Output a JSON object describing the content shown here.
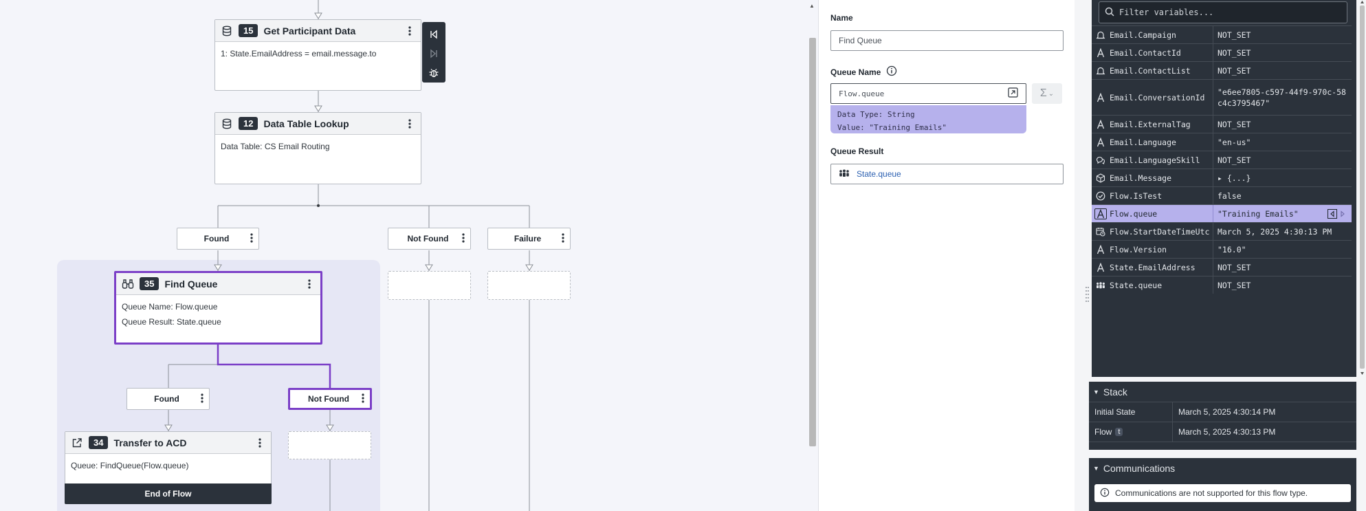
{
  "canvas": {
    "get_participant": {
      "number": "15",
      "title": "Get Participant Data",
      "line1": "1: State.EmailAddress = email.message.to"
    },
    "data_table_lookup": {
      "number": "12",
      "title": "Data Table Lookup",
      "line1": "Data Table: CS Email Routing"
    },
    "branches": {
      "found": "Found",
      "not_found": "Not Found",
      "failure": "Failure"
    },
    "find_queue": {
      "number": "35",
      "title": "Find Queue",
      "line1": "Queue Name: Flow.queue",
      "line2": "Queue Result: State.queue"
    },
    "inner_branches": {
      "found": "Found",
      "not_found": "Not Found"
    },
    "transfer": {
      "number": "34",
      "title": "Transfer to ACD",
      "line1": "Queue: FindQueue(Flow.queue)",
      "end": "End of Flow"
    }
  },
  "properties": {
    "name_label": "Name",
    "name_value": "Find Queue",
    "queue_name_label": "Queue Name",
    "queue_name_value": "Flow.queue",
    "tooltip_type": "Data Type: String",
    "tooltip_value": "Value:  \"Training Emails\"",
    "queue_result_label": "Queue Result",
    "queue_result_value": "State.queue"
  },
  "variables": {
    "filter_placeholder": "Filter variables...",
    "rows": [
      {
        "icon": "bell-icon",
        "name": "Email.Campaign",
        "value": "NOT_SET"
      },
      {
        "icon": "text-icon",
        "name": "Email.ContactId",
        "value": "NOT_SET"
      },
      {
        "icon": "bell-icon",
        "name": "Email.ContactList",
        "value": "NOT_SET"
      },
      {
        "icon": "text-icon",
        "name": "Email.ConversationId",
        "value": "\"e6ee7805-c597-44f9-970c-58c4c3795467\""
      },
      {
        "icon": "text-icon",
        "name": "Email.ExternalTag",
        "value": "NOT_SET"
      },
      {
        "icon": "text-icon",
        "name": "Email.Language",
        "value": "\"en-us\""
      },
      {
        "icon": "chat-icon",
        "name": "Email.LanguageSkill",
        "value": "NOT_SET"
      },
      {
        "icon": "cube-icon",
        "name": "Email.Message",
        "value": "▸ {...}"
      },
      {
        "icon": "check-circle-icon",
        "name": "Flow.IsTest",
        "value": "false"
      },
      {
        "icon": "text-icon",
        "name": "Flow.queue",
        "value": "\"Training Emails\""
      },
      {
        "icon": "calendar-clock-icon",
        "name": "Flow.StartDateTimeUtc",
        "value": "March 5, 2025 4:30:13 PM"
      },
      {
        "icon": "text-icon",
        "name": "Flow.Version",
        "value": "\"16.0\""
      },
      {
        "icon": "text-icon",
        "name": "State.EmailAddress",
        "value": "NOT_SET"
      },
      {
        "icon": "people-icon",
        "name": "State.queue",
        "value": "NOT_SET"
      }
    ]
  },
  "stack": {
    "title": "Stack",
    "rows": [
      {
        "key": "Initial State",
        "badge": "",
        "value": "March 5, 2025 4:30:14 PM"
      },
      {
        "key": "Flow",
        "badge": "t",
        "value": "March 5, 2025 4:30:13 PM"
      }
    ]
  },
  "communications": {
    "title": "Communications",
    "notice": "Communications are not supported for this flow type."
  }
}
